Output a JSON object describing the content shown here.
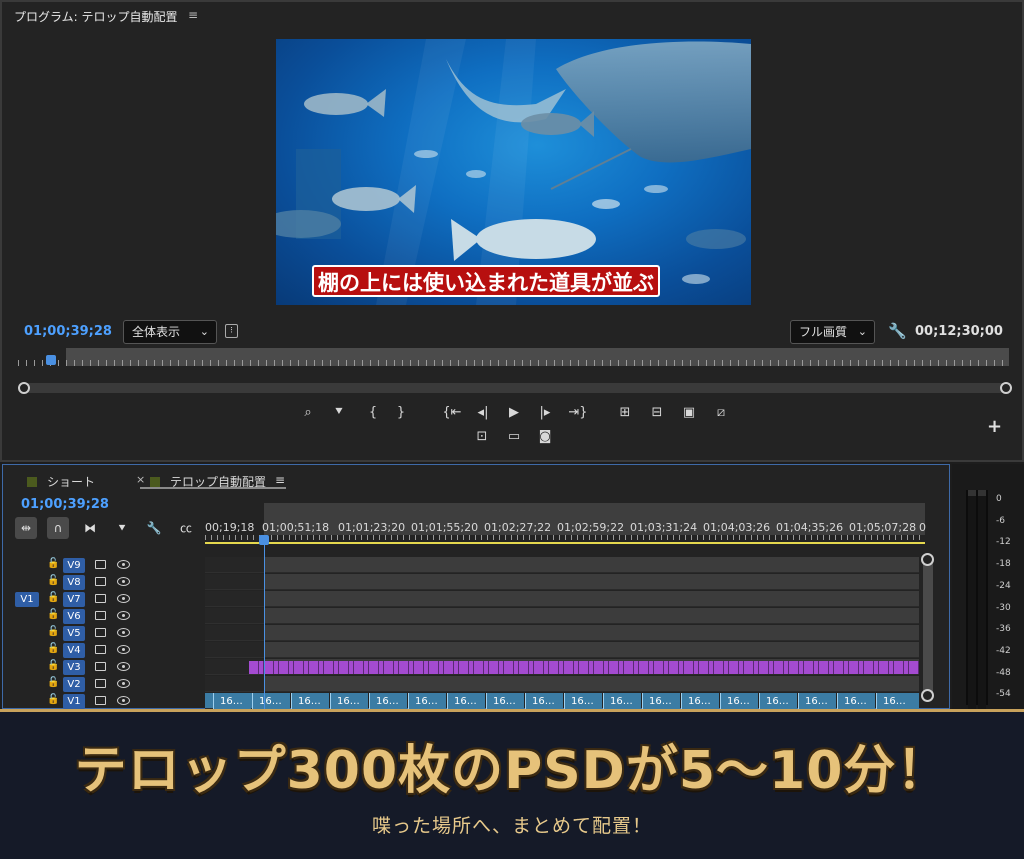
{
  "program_monitor": {
    "title": "プログラム: テロップ自動配置",
    "menu_glyph": "≡",
    "caption": "棚の上には使い込まれた道具が並ぶ",
    "timecode_current": "01;00;39;28",
    "fit_dropdown": "全体表示",
    "quality_dropdown": "フル画質",
    "timecode_duration": "00;12;30;00",
    "transport_icons": [
      "marker-icon",
      "in-point-icon",
      "out-point-icon",
      "go-to-in-icon",
      "step-back-icon",
      "play-icon",
      "step-forward-icon",
      "go-to-out-icon",
      "lift-icon",
      "extract-icon",
      "export-frame-icon",
      "insert-icon",
      "camera-icon",
      "comparison-view-icon",
      "safe-margins-icon"
    ],
    "add_button": "+"
  },
  "timeline": {
    "tabs": [
      {
        "label": "ショート",
        "active": false
      },
      {
        "label": "テロップ自動配置",
        "active": true
      }
    ],
    "close_glyph": "×",
    "menu_glyph": "≡",
    "timecode": "01;00;39;28",
    "ruler_labels": [
      "00;19;18",
      "01;00;51;18",
      "01;01;23;20",
      "01;01;55;20",
      "01;02;27;22",
      "01;02;59;22",
      "01;03;31;24",
      "01;04;03;26",
      "01;04;35;26",
      "01;05;07;28",
      "0"
    ],
    "source_patch": "V1",
    "tracks": [
      "V9",
      "V8",
      "V7",
      "V6",
      "V5",
      "V4",
      "V3",
      "V2",
      "V1"
    ],
    "clip_label": "16…",
    "clip_count": 18
  },
  "audio_meter": {
    "scale": [
      "0",
      "-6",
      "-12",
      "-18",
      "-24",
      "-30",
      "-36",
      "-42",
      "-48",
      "-54"
    ]
  },
  "banner": {
    "headline": "テロップ300枚のPSDが5～10分！",
    "subline": "喋った場所へ、まとめて配置！"
  },
  "colors": {
    "accent_timecode": "#4da0ff",
    "playhead": "#4a90e2",
    "track_patch": "#2f5ea6",
    "clip_v1": "#3b7ca4",
    "clip_v3": "#a44bd1",
    "headline_gold": "#e6c27a",
    "caption_red": "#b70f0f"
  }
}
